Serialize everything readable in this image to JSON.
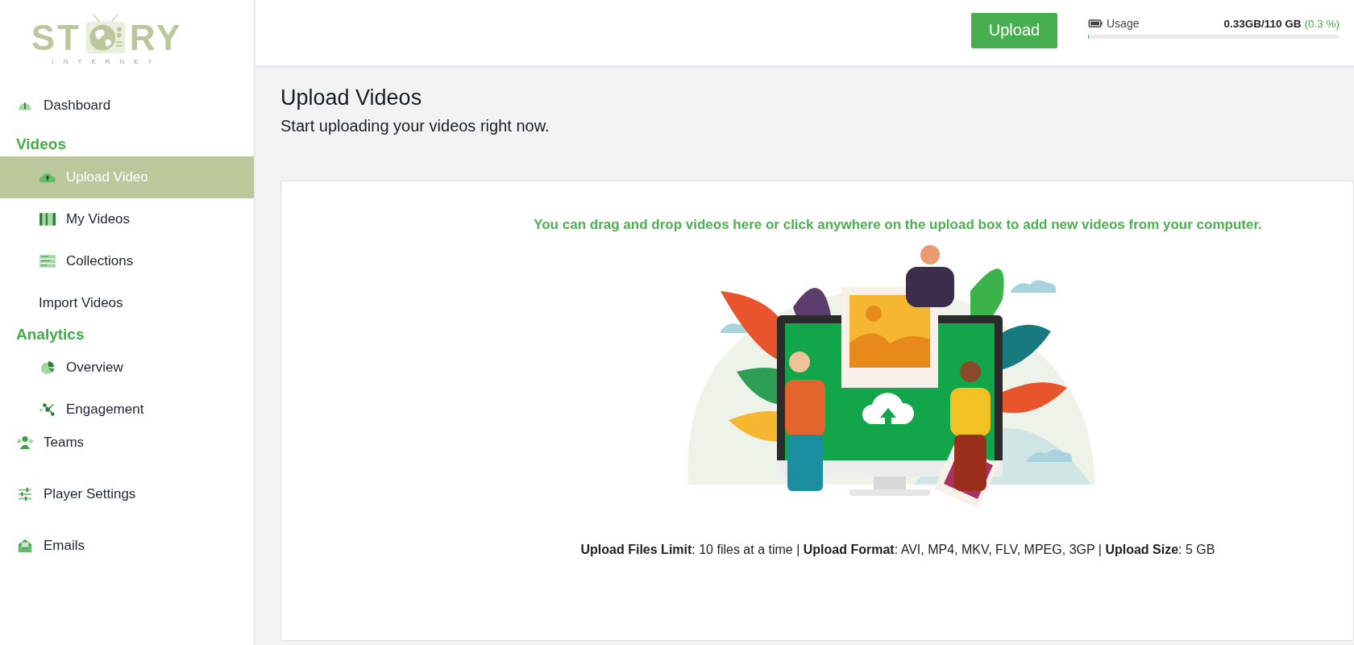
{
  "logo": {
    "left": "ST",
    "right": "RY",
    "tagline": "INTERNET"
  },
  "sidebar": {
    "items": [
      {
        "kind": "link",
        "label": "Dashboard",
        "selected": false
      },
      {
        "kind": "group",
        "label": "Videos",
        "children": [
          {
            "label": "Upload Video",
            "selected": true
          },
          {
            "label": "My Videos",
            "selected": false
          },
          {
            "label": "Collections",
            "selected": false
          },
          {
            "label": "Import Videos",
            "selected": false
          }
        ]
      },
      {
        "kind": "group",
        "label": "Analytics",
        "children": [
          {
            "label": "Overview",
            "selected": false
          },
          {
            "label": "Engagement",
            "selected": false
          }
        ]
      },
      {
        "kind": "link",
        "label": "Teams",
        "selected": false
      },
      {
        "kind": "link",
        "label": "Player Settings",
        "selected": false
      },
      {
        "kind": "link",
        "label": "Emails",
        "selected": false
      }
    ]
  },
  "header": {
    "upload_button": "Upload",
    "usage": {
      "label": "Usage",
      "amount": "0.33GB/110 GB",
      "percent": "(0.3 %)",
      "level": 0.003
    }
  },
  "page": {
    "title": "Upload Videos",
    "subtitle": "Start uploading your videos right now."
  },
  "dropzone": {
    "hint": "You can drag and drop videos here or click anywhere on the upload box to add new videos from your computer.",
    "limits": "**Upload Files Limit**: 10 files at a time | **Upload Format**: AVI, MP4, MKV, FLV, MPEG, 3GP | **Upload Size**: 5 GB"
  }
}
